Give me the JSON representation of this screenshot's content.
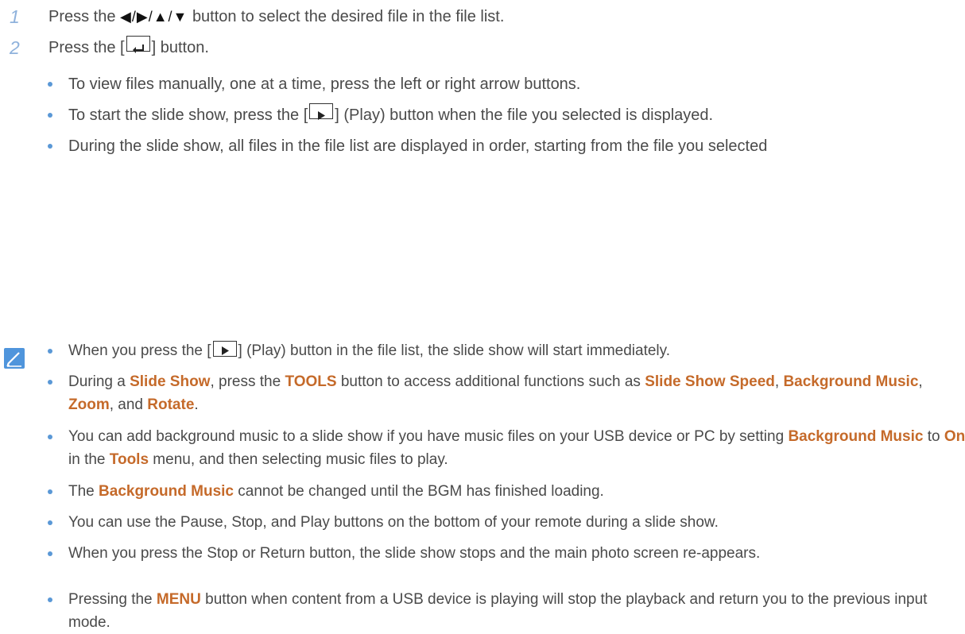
{
  "steps": [
    {
      "number": "1",
      "text_before": "Press the",
      "arrows": "◀/▶/▲/▼",
      "text_after": "button to select the desired file in the file list."
    },
    {
      "number": "2",
      "text_before": "Press the [",
      "icon": "enter-icon",
      "text_after": "] button."
    }
  ],
  "sub_bullets": [
    {
      "text": "To view files manually, one at a time, press the left or right arrow buttons."
    },
    {
      "before": "To start the slide show, press the [",
      "icon": "play-icon",
      "after": "] (Play) button when the file you selected is displayed."
    },
    {
      "text": "During the slide show, all files in the file list are displayed in order, starting from the file you selected"
    }
  ],
  "note_icon": "pencil-note-icon",
  "notes": {
    "n1": {
      "before": "When you press the [",
      "icon": "play-icon",
      "after": "] (Play) button in the file list, the slide show will start immediately."
    },
    "n2": {
      "p1": "During a ",
      "h1": "Slide Show",
      "p2": ", press the ",
      "h2": "TOOLS",
      "p3": " button to access additional functions such as ",
      "h3": "Slide Show Speed",
      "p4": ", ",
      "h4": "Background Music",
      "p5": ", ",
      "h5": "Zoom",
      "p6": ", and ",
      "h6": "Rotate",
      "p7": "."
    },
    "n3": {
      "p1": "You can add background music to a slide show if you have music files on your USB device or PC by setting ",
      "h1": "Background Music",
      "p2": " to ",
      "h2": "On",
      "p3": " in the ",
      "h3": "Tools",
      "p4": " menu, and then selecting music files to play."
    },
    "n4": {
      "p1": "The ",
      "h1": "Background Music",
      "p2": " cannot be changed until the BGM has finished loading."
    },
    "n5": {
      "text": "You can use the Pause, Stop, and Play buttons on the bottom of your remote during a slide show."
    },
    "n6": {
      "text": "When you press the Stop or Return button, the slide show stops and the main photo screen re-appears."
    },
    "n7": {
      "p1": "Pressing the ",
      "h1": "MENU",
      "p2": " button when content from a USB device is playing will stop the playback and return you to the previous input mode."
    }
  },
  "colors": {
    "highlight": "#c56a2a",
    "step_number": "#8fb2dc",
    "bullet": "#5a98d6",
    "text": "#4a4a4a"
  }
}
